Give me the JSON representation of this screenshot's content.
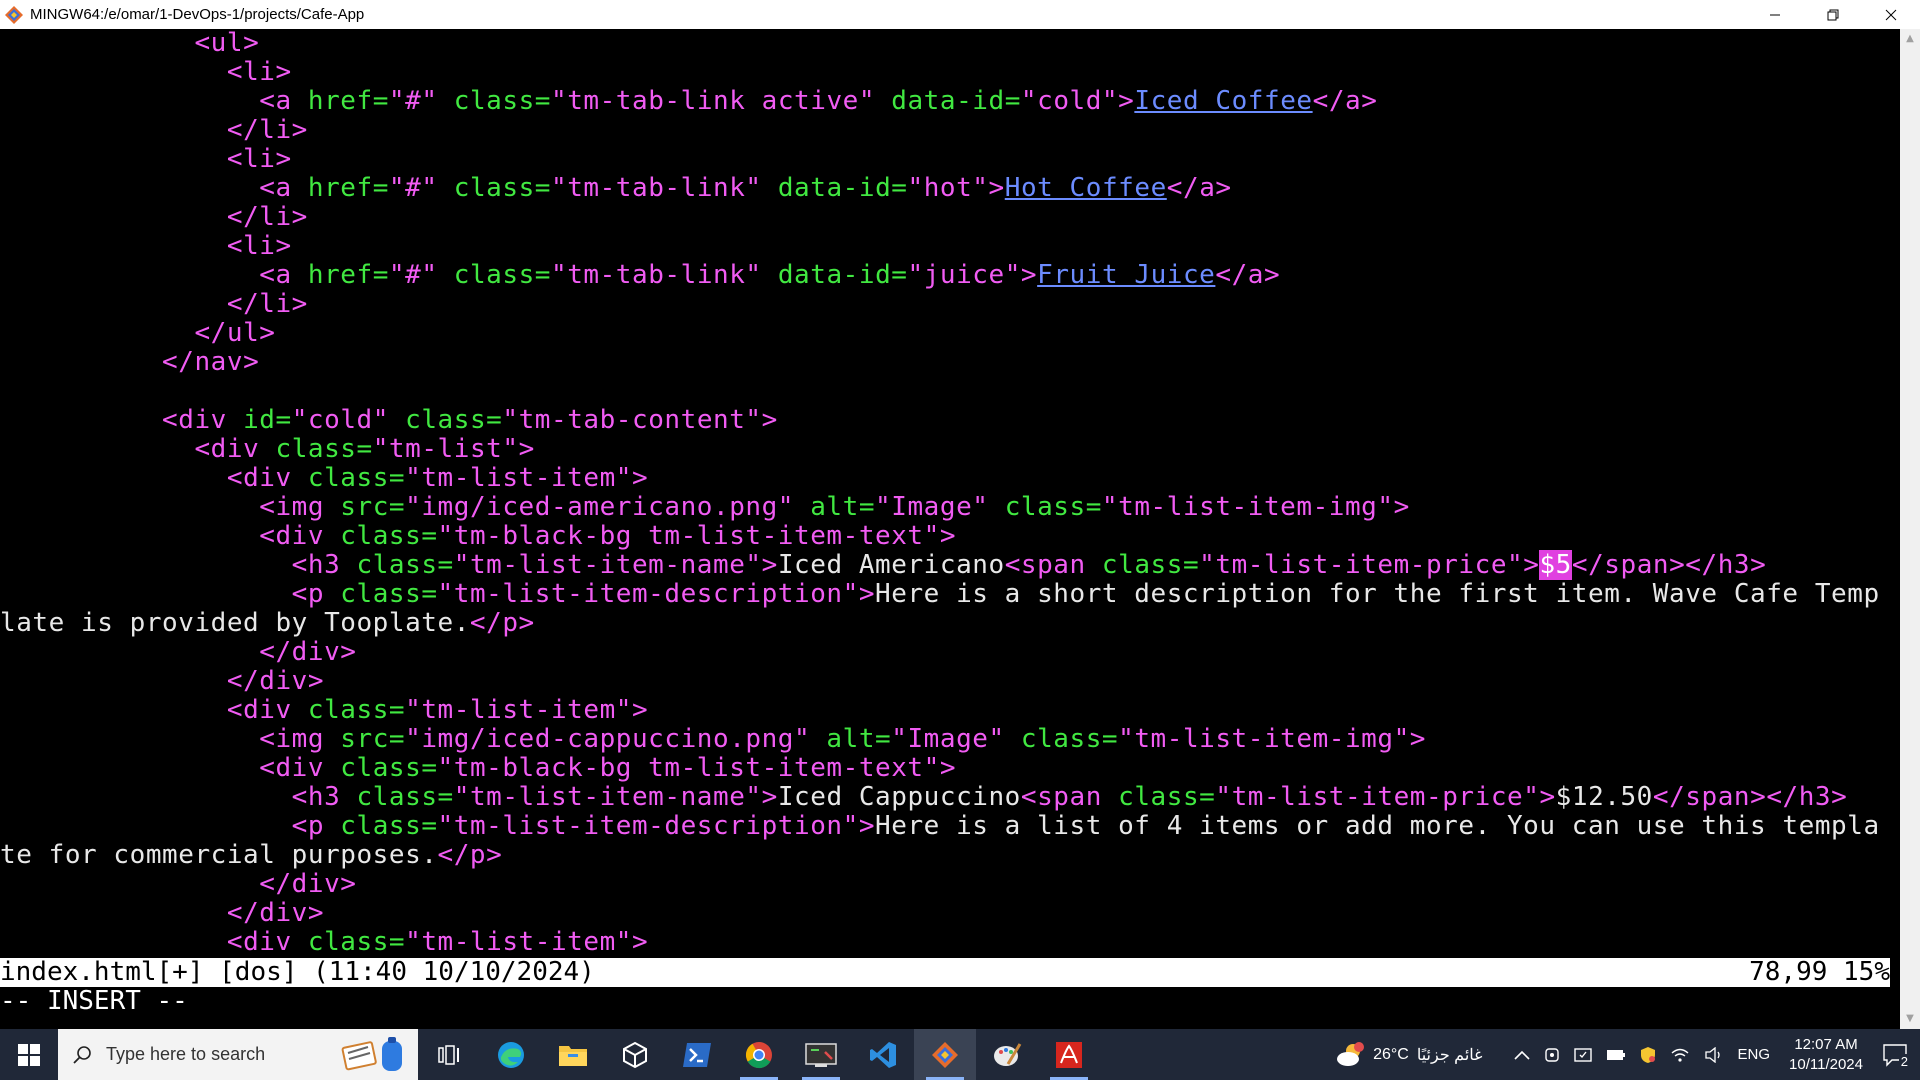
{
  "window": {
    "title": "MINGW64:/e/omar/1-DevOps-1/projects/Cafe-App",
    "minimize_icon": "minimize-icon",
    "maximize_icon": "restore-icon",
    "close_icon": "close-icon"
  },
  "editor": {
    "lines": [
      [
        {
          "t": "            ",
          "c": "txt"
        },
        {
          "t": "<ul>",
          "c": "tag"
        }
      ],
      [
        {
          "t": "              ",
          "c": "txt"
        },
        {
          "t": "<li>",
          "c": "tag"
        }
      ],
      [
        {
          "t": "                ",
          "c": "txt"
        },
        {
          "t": "<a ",
          "c": "tag"
        },
        {
          "t": "href=",
          "c": "attr"
        },
        {
          "t": "\"#\" ",
          "c": "str"
        },
        {
          "t": "class=",
          "c": "attr"
        },
        {
          "t": "\"tm-tab-link active\" ",
          "c": "str"
        },
        {
          "t": "data-id=",
          "c": "attr"
        },
        {
          "t": "\"cold\"",
          "c": "str"
        },
        {
          "t": ">",
          "c": "tag"
        },
        {
          "t": "Iced Coffee",
          "c": "link"
        },
        {
          "t": "</a>",
          "c": "tag"
        }
      ],
      [
        {
          "t": "              ",
          "c": "txt"
        },
        {
          "t": "</li>",
          "c": "tag"
        }
      ],
      [
        {
          "t": "              ",
          "c": "txt"
        },
        {
          "t": "<li>",
          "c": "tag"
        }
      ],
      [
        {
          "t": "                ",
          "c": "txt"
        },
        {
          "t": "<a ",
          "c": "tag"
        },
        {
          "t": "href=",
          "c": "attr"
        },
        {
          "t": "\"#\" ",
          "c": "str"
        },
        {
          "t": "class=",
          "c": "attr"
        },
        {
          "t": "\"tm-tab-link\" ",
          "c": "str"
        },
        {
          "t": "data-id=",
          "c": "attr"
        },
        {
          "t": "\"hot\"",
          "c": "str"
        },
        {
          "t": ">",
          "c": "tag"
        },
        {
          "t": "Hot Coffee",
          "c": "link"
        },
        {
          "t": "</a>",
          "c": "tag"
        }
      ],
      [
        {
          "t": "              ",
          "c": "txt"
        },
        {
          "t": "</li>",
          "c": "tag"
        }
      ],
      [
        {
          "t": "              ",
          "c": "txt"
        },
        {
          "t": "<li>",
          "c": "tag"
        }
      ],
      [
        {
          "t": "                ",
          "c": "txt"
        },
        {
          "t": "<a ",
          "c": "tag"
        },
        {
          "t": "href=",
          "c": "attr"
        },
        {
          "t": "\"#\" ",
          "c": "str"
        },
        {
          "t": "class=",
          "c": "attr"
        },
        {
          "t": "\"tm-tab-link\" ",
          "c": "str"
        },
        {
          "t": "data-id=",
          "c": "attr"
        },
        {
          "t": "\"juice\"",
          "c": "str"
        },
        {
          "t": ">",
          "c": "tag"
        },
        {
          "t": "Fruit Juice",
          "c": "link"
        },
        {
          "t": "</a>",
          "c": "tag"
        }
      ],
      [
        {
          "t": "              ",
          "c": "txt"
        },
        {
          "t": "</li>",
          "c": "tag"
        }
      ],
      [
        {
          "t": "            ",
          "c": "txt"
        },
        {
          "t": "</ul>",
          "c": "tag"
        }
      ],
      [
        {
          "t": "          ",
          "c": "txt"
        },
        {
          "t": "</nav>",
          "c": "tag"
        }
      ],
      [
        {
          "t": "",
          "c": "txt"
        }
      ],
      [
        {
          "t": "          ",
          "c": "txt"
        },
        {
          "t": "<div ",
          "c": "tag"
        },
        {
          "t": "id=",
          "c": "attr"
        },
        {
          "t": "\"cold\" ",
          "c": "str"
        },
        {
          "t": "class=",
          "c": "attr"
        },
        {
          "t": "\"tm-tab-content\"",
          "c": "str"
        },
        {
          "t": ">",
          "c": "tag"
        }
      ],
      [
        {
          "t": "            ",
          "c": "txt"
        },
        {
          "t": "<div ",
          "c": "tag"
        },
        {
          "t": "class=",
          "c": "attr"
        },
        {
          "t": "\"tm-list\"",
          "c": "str"
        },
        {
          "t": ">",
          "c": "tag"
        }
      ],
      [
        {
          "t": "              ",
          "c": "txt"
        },
        {
          "t": "<div ",
          "c": "tag"
        },
        {
          "t": "class=",
          "c": "attr"
        },
        {
          "t": "\"tm-list-item\"",
          "c": "str"
        },
        {
          "t": ">",
          "c": "tag"
        }
      ],
      [
        {
          "t": "                ",
          "c": "txt"
        },
        {
          "t": "<img ",
          "c": "tag"
        },
        {
          "t": "src=",
          "c": "attr"
        },
        {
          "t": "\"img/iced-americano.png\" ",
          "c": "str"
        },
        {
          "t": "alt=",
          "c": "attr"
        },
        {
          "t": "\"Image\" ",
          "c": "str"
        },
        {
          "t": "class=",
          "c": "attr"
        },
        {
          "t": "\"tm-list-item-img\"",
          "c": "str"
        },
        {
          "t": ">",
          "c": "tag"
        }
      ],
      [
        {
          "t": "                ",
          "c": "txt"
        },
        {
          "t": "<div ",
          "c": "tag"
        },
        {
          "t": "class=",
          "c": "attr"
        },
        {
          "t": "\"tm-black-bg tm-list-item-text\"",
          "c": "str"
        },
        {
          "t": ">",
          "c": "tag"
        }
      ],
      [
        {
          "t": "                  ",
          "c": "txt"
        },
        {
          "t": "<h3 ",
          "c": "tag"
        },
        {
          "t": "class=",
          "c": "attr"
        },
        {
          "t": "\"tm-list-item-name\"",
          "c": "str"
        },
        {
          "t": ">",
          "c": "tag"
        },
        {
          "t": "Iced Americano",
          "c": "txt"
        },
        {
          "t": "<span ",
          "c": "tag"
        },
        {
          "t": "class=",
          "c": "attr"
        },
        {
          "t": "\"tm-list-item-price\"",
          "c": "str"
        },
        {
          "t": ">",
          "c": "tag"
        },
        {
          "t": "$5",
          "c": "cursor"
        },
        {
          "t": "</span></h3>",
          "c": "tag"
        }
      ],
      [
        {
          "t": "                  ",
          "c": "txt"
        },
        {
          "t": "<p ",
          "c": "tag"
        },
        {
          "t": "class=",
          "c": "attr"
        },
        {
          "t": "\"tm-list-item-description\"",
          "c": "str"
        },
        {
          "t": ">",
          "c": "tag"
        },
        {
          "t": "Here is a short description for the first item. Wave Cafe Temp",
          "c": "txt"
        }
      ],
      [
        {
          "t": "late is provided by Tooplate.",
          "c": "txt"
        },
        {
          "t": "</p>",
          "c": "tag"
        }
      ],
      [
        {
          "t": "                ",
          "c": "txt"
        },
        {
          "t": "</div>",
          "c": "tag"
        }
      ],
      [
        {
          "t": "              ",
          "c": "txt"
        },
        {
          "t": "</div>",
          "c": "tag"
        }
      ],
      [
        {
          "t": "              ",
          "c": "txt"
        },
        {
          "t": "<div ",
          "c": "tag"
        },
        {
          "t": "class=",
          "c": "attr"
        },
        {
          "t": "\"tm-list-item\"",
          "c": "str"
        },
        {
          "t": ">",
          "c": "tag"
        }
      ],
      [
        {
          "t": "                ",
          "c": "txt"
        },
        {
          "t": "<img ",
          "c": "tag"
        },
        {
          "t": "src=",
          "c": "attr"
        },
        {
          "t": "\"img/iced-cappuccino.png\" ",
          "c": "str"
        },
        {
          "t": "alt=",
          "c": "attr"
        },
        {
          "t": "\"Image\" ",
          "c": "str"
        },
        {
          "t": "class=",
          "c": "attr"
        },
        {
          "t": "\"tm-list-item-img\"",
          "c": "str"
        },
        {
          "t": ">",
          "c": "tag"
        }
      ],
      [
        {
          "t": "                ",
          "c": "txt"
        },
        {
          "t": "<div ",
          "c": "tag"
        },
        {
          "t": "class=",
          "c": "attr"
        },
        {
          "t": "\"tm-black-bg tm-list-item-text\"",
          "c": "str"
        },
        {
          "t": ">",
          "c": "tag"
        }
      ],
      [
        {
          "t": "                  ",
          "c": "txt"
        },
        {
          "t": "<h3 ",
          "c": "tag"
        },
        {
          "t": "class=",
          "c": "attr"
        },
        {
          "t": "\"tm-list-item-name\"",
          "c": "str"
        },
        {
          "t": ">",
          "c": "tag"
        },
        {
          "t": "Iced Cappuccino",
          "c": "txt"
        },
        {
          "t": "<span ",
          "c": "tag"
        },
        {
          "t": "class=",
          "c": "attr"
        },
        {
          "t": "\"tm-list-item-price\"",
          "c": "str"
        },
        {
          "t": ">",
          "c": "tag"
        },
        {
          "t": "$12.50",
          "c": "txt"
        },
        {
          "t": "</span></h3>",
          "c": "tag"
        }
      ],
      [
        {
          "t": "                  ",
          "c": "txt"
        },
        {
          "t": "<p ",
          "c": "tag"
        },
        {
          "t": "class=",
          "c": "attr"
        },
        {
          "t": "\"tm-list-item-description\"",
          "c": "str"
        },
        {
          "t": ">",
          "c": "tag"
        },
        {
          "t": "Here is a list of 4 items or add more. You can use this templa",
          "c": "txt"
        }
      ],
      [
        {
          "t": "te for commercial purposes.",
          "c": "txt"
        },
        {
          "t": "</p>",
          "c": "tag"
        }
      ],
      [
        {
          "t": "                ",
          "c": "txt"
        },
        {
          "t": "</div>",
          "c": "tag"
        }
      ],
      [
        {
          "t": "              ",
          "c": "txt"
        },
        {
          "t": "</div>",
          "c": "tag"
        }
      ],
      [
        {
          "t": "              ",
          "c": "txt"
        },
        {
          "t": "<div ",
          "c": "tag"
        },
        {
          "t": "class=",
          "c": "attr"
        },
        {
          "t": "\"tm-list-item\"",
          "c": "str"
        },
        {
          "t": ">",
          "c": "tag"
        }
      ]
    ],
    "status_left": "index.html[+] [dos] (11:40 10/10/2024)",
    "status_right": "78,99 15%",
    "mode": "-- INSERT --"
  },
  "taskbar": {
    "search_placeholder": "Type here to search",
    "weather_temp": "26°C",
    "weather_text": "غائم جزئيًا",
    "language": "ENG",
    "time": "12:07 AM",
    "date": "10/11/2024",
    "notification_count": "2",
    "apps": [
      "task-view-icon",
      "edge-icon",
      "file-explorer-icon",
      "cube-app-icon",
      "powershell-icon",
      "chrome-icon",
      "screen-app-icon",
      "vscode-icon",
      "git-bash-icon",
      "paint-icon",
      "acrobat-icon"
    ]
  },
  "colors": {
    "tag": "#f15cf3",
    "attr": "#41e841",
    "link": "#6c8cff",
    "cursor": "#e040e0"
  }
}
